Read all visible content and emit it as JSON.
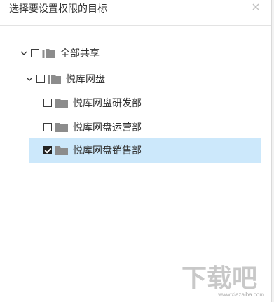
{
  "dialog": {
    "title": "选择要设置权限的目标",
    "close_icon": "close-icon"
  },
  "tree": {
    "items": [
      {
        "label": "全部共享",
        "level": 0,
        "expanded": true,
        "checked": false,
        "selected": false,
        "icon": "folder-group-icon"
      },
      {
        "label": "悦库网盘",
        "level": 1,
        "expanded": true,
        "checked": false,
        "selected": false,
        "icon": "folder-group-icon"
      },
      {
        "label": "悦库网盘研发部",
        "level": 2,
        "expanded": false,
        "checked": false,
        "selected": false,
        "icon": "folder-icon"
      },
      {
        "label": "悦库网盘运营部",
        "level": 2,
        "expanded": false,
        "checked": false,
        "selected": false,
        "icon": "folder-icon"
      },
      {
        "label": "悦库网盘销售部",
        "level": 2,
        "expanded": false,
        "checked": true,
        "selected": true,
        "icon": "folder-icon"
      }
    ]
  },
  "watermark": {
    "logo_text": "下载吧",
    "url_text": "www.xiazaiba.com"
  },
  "colors": {
    "selected_row_bg": "#cce8fb",
    "folder_gray": "#8c8c8c",
    "text": "#333333"
  }
}
